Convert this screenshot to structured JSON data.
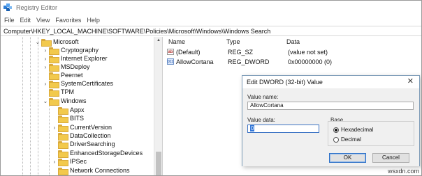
{
  "window": {
    "title": "Registry Editor"
  },
  "menu": [
    "File",
    "Edit",
    "View",
    "Favorites",
    "Help"
  ],
  "address": "Computer\\HKEY_LOCAL_MACHINE\\SOFTWARE\\Policies\\Microsoft\\Windows\\Windows Search",
  "tree": {
    "items": [
      {
        "label": "Microsoft",
        "expander": "⌄"
      },
      {
        "label": "Cryptography",
        "expander": "›"
      },
      {
        "label": "Internet Explorer",
        "expander": "›"
      },
      {
        "label": "MSDeploy",
        "expander": "›"
      },
      {
        "label": "Peernet",
        "expander": ""
      },
      {
        "label": "SystemCertificates",
        "expander": "›"
      },
      {
        "label": "TPM",
        "expander": ""
      },
      {
        "label": "Windows",
        "expander": "⌄"
      },
      {
        "label": "Appx",
        "expander": ""
      },
      {
        "label": "BITS",
        "expander": ""
      },
      {
        "label": "CurrentVersion",
        "expander": "›"
      },
      {
        "label": "DataCollection",
        "expander": ""
      },
      {
        "label": "DriverSearching",
        "expander": ""
      },
      {
        "label": "EnhancedStorageDevices",
        "expander": ""
      },
      {
        "label": "IPSec",
        "expander": "›"
      },
      {
        "label": "Network Connections",
        "expander": ""
      }
    ]
  },
  "values": {
    "columns": [
      "Name",
      "Type",
      "Data"
    ],
    "rows": [
      {
        "icon": "ab",
        "name": "(Default)",
        "type": "REG_SZ",
        "data": "(value not set)"
      },
      {
        "icon": "011",
        "name": "AllowCortana",
        "type": "REG_DWORD",
        "data": "0x00000000 (0)"
      }
    ]
  },
  "dialog": {
    "title": "Edit DWORD (32-bit) Value",
    "close": "✕",
    "value_name_label": "Value name:",
    "value_name": "AllowCortana",
    "value_data_label": "Value data:",
    "value_data": "0",
    "base_label": "Base",
    "hex_label": "Hexadecimal",
    "dec_label": "Decimal",
    "base_selected": "Hexadecimal",
    "ok_label": "OK",
    "cancel_label": "Cancel"
  },
  "watermark": "wsxdn.com"
}
